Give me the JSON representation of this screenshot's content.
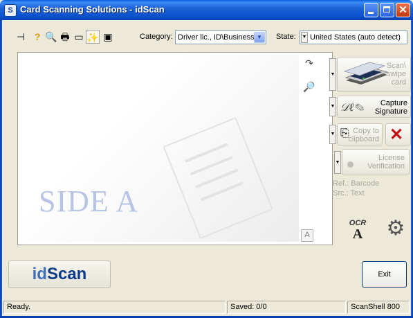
{
  "window": {
    "title": "Card Scanning Solutions - idScan",
    "icon_glyph": "S",
    "controls": {
      "minimize": "minimize-icon",
      "maximize": "maximize-icon",
      "close": "✕"
    }
  },
  "toolbar": {
    "icons": [
      {
        "name": "pin-icon",
        "glyph": "⊣"
      },
      {
        "name": "help-icon",
        "glyph": "?"
      },
      {
        "name": "preview-icon",
        "glyph": "🔍"
      },
      {
        "name": "print-icon",
        "glyph": "🖶"
      },
      {
        "name": "card-icon",
        "glyph": "▭"
      },
      {
        "name": "magic-wand-icon",
        "glyph": "✨"
      },
      {
        "name": "scan-settings-icon",
        "glyph": "▣"
      }
    ],
    "category_label": "Category:",
    "category_value": "Driver lic., ID\\Business c",
    "state_label": "State:",
    "state_value": "United States (auto detect)"
  },
  "scan": {
    "side_label": "SIDE A",
    "rotate_icon": "↷",
    "zoom_icon": "🔎",
    "text_toggle": "A"
  },
  "actions": {
    "scan_label": "Scan\\ swipe card",
    "scan_line1": "Scan\\",
    "scan_line2": "swipe",
    "scan_line3": "card",
    "capture_line1": "Capture",
    "capture_line2": "Signature",
    "copy_line1": "Copy to",
    "copy_line2": "clipboard",
    "license_line1": "License",
    "license_line2": "Verification",
    "ref_text": "Ref.: Barcode",
    "src_text": "Src.: Text",
    "ocr_label": "OCR",
    "ocr_letter": "A"
  },
  "bottom": {
    "logo_id": "id",
    "logo_scan": "Scan",
    "exit_label": "Exit"
  },
  "status": {
    "left": "Ready.",
    "middle": "Saved: 0/0",
    "right": "ScanShell 800"
  },
  "colors": {
    "titlebar": "#0A4FCB",
    "side_label": "#B8C4E4",
    "delete": "#C21010"
  }
}
